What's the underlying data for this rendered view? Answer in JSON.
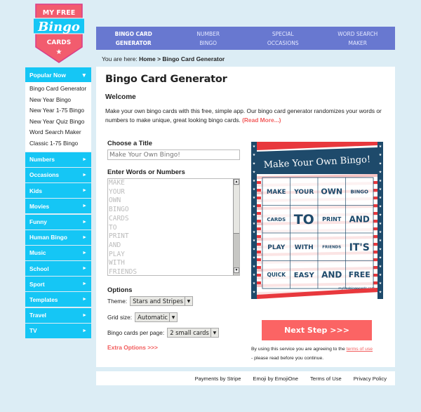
{
  "logo": {
    "line1": "MY FREE",
    "line2": "Bingo",
    "line3": "CARDS"
  },
  "topnav": [
    {
      "line1": "Bingo Card",
      "line2": "Generator",
      "active": true
    },
    {
      "line1": "Number",
      "line2": "Bingo",
      "active": false
    },
    {
      "line1": "Special",
      "line2": "Occasions",
      "active": false
    },
    {
      "line1": "Word Search",
      "line2": "Maker",
      "active": false
    }
  ],
  "breadcrumb": {
    "prefix": "You are here: ",
    "home": "Home",
    "sep": " > ",
    "current": "Bingo Card Generator"
  },
  "sidebar": {
    "popular_label": "Popular Now",
    "popular_arrow": "▼",
    "popular_items": [
      "Bingo Card Generator",
      "New Year Bingo",
      "New Year 1-75 Bingo",
      "New Year Quiz Bingo",
      "Word Search Maker",
      "Classic 1-75 Bingo"
    ],
    "categories": [
      "Numbers",
      "Occasions",
      "Kids",
      "Movies",
      "Funny",
      "Human Bingo",
      "Music",
      "School",
      "Sport",
      "Templates",
      "Travel",
      "TV"
    ],
    "cat_arrow": "►"
  },
  "main": {
    "title": "Bingo Card Generator",
    "welcome": "Welcome",
    "intro": "Make your own bingo cards with this free, simple app. Our bingo card generator randomizes your words or numbers to make unique, great looking bingo cards. ",
    "read_more": "(Read More...)",
    "choose_title_label": "Choose a Title",
    "title_placeholder": "Make Your Own Bingo!",
    "words_label": "Enter Words or Numbers",
    "words_placeholder": "MAKE\nYOUR\nOWN\nBINGO\nCARDS\nTO\nPRINT\nAND\nPLAY\nWITH\nFRIENDS",
    "options_label": "Options",
    "theme_label": "Theme:",
    "theme_value": "Stars and Stripes",
    "grid_label": "Grid size:",
    "grid_value": "Automatic",
    "per_page_label": "Bingo cards per page:",
    "per_page_value": "2 small cards",
    "extra_options": "Extra Options >>>",
    "next_button": "Next Step >>>",
    "agree_text": "By using this service you are agreeing to the ",
    "terms_link": "terms of use",
    "agree_suffix": "- please read before you continue."
  },
  "preview": {
    "title": "Make Your Own Bingo!",
    "cells": [
      "MAKE",
      "YOUR",
      "OWN",
      "BINGO",
      "CARDS",
      "TO",
      "PRINT",
      "AND",
      "PLAY",
      "WITH",
      "FRIENDS",
      "IT'S",
      "QUICK",
      "EASY",
      "AND",
      "FREE"
    ],
    "watermark": "myfreebingocards.com",
    "colors": {
      "navy": "#1e4a6b",
      "red": "#e8383d",
      "pink_stripe": "#fbe3e3"
    }
  },
  "footer": [
    "Payments by Stripe",
    "Emoji by EmojiOne",
    "Terms of Use",
    "Privacy Policy"
  ],
  "colors": {
    "accent_blue": "#15c6f5",
    "nav_blue": "#6878d0",
    "coral": "#fb6464",
    "background": "#dcedf5"
  }
}
